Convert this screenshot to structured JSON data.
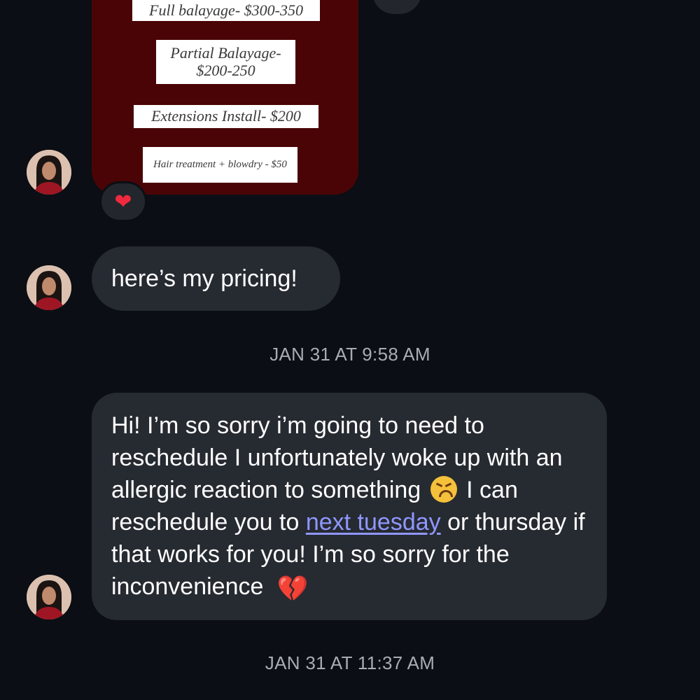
{
  "pricing_image": {
    "items": [
      "Full balayage- $300-350",
      "Partial Balayage- $200-250",
      "Extensions Install- $200",
      "Hair treatment + blowdry - $50"
    ]
  },
  "reaction": {
    "icon": "red-heart-icon",
    "glyph": "❤"
  },
  "messages": [
    {
      "text": "here’s my pricing!"
    },
    {
      "parts": {
        "before_emoji": "Hi! I’m so sorry i’m going to need to reschedule I unfortunately woke up with an allergic reaction to something",
        "after_emoji": " I can reschedule you to ",
        "link": "next tuesday",
        "after_link": " or thursday if that works for you! I’m so sorry for the inconvenience",
        "end_emoji_icon": "broken-heart-icon",
        "end_emoji_glyph": "💔"
      }
    }
  ],
  "timestamps": [
    "JAN 31 AT 9:58 AM",
    "JAN 31 AT 11:37 AM"
  ],
  "colors": {
    "background": "#0b0e14",
    "bubble": "#262a31",
    "link": "#8f97ff",
    "card": "#4a0406",
    "timestamp": "#a9acb3"
  }
}
